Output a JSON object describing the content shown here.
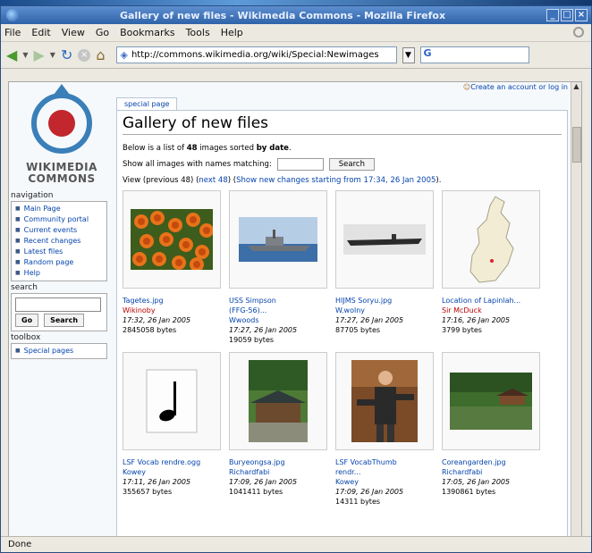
{
  "window": {
    "title": "Gallery of new files - Wikimedia Commons - Mozilla Firefox"
  },
  "menu": [
    "File",
    "Edit",
    "View",
    "Go",
    "Bookmarks",
    "Tools",
    "Help"
  ],
  "address": {
    "url": "http://commons.wikimedia.org/wiki/Special:Newimages"
  },
  "sidebar": {
    "logo_line1": "WIKIMEDIA",
    "logo_line2": "COMMONS",
    "nav_heading": "navigation",
    "nav_items": [
      "Main Page",
      "Community portal",
      "Current events",
      "Recent changes",
      "Latest files",
      "Random page",
      "Help"
    ],
    "search_heading": "search",
    "search_go": "Go",
    "search_btn": "Search",
    "toolbox_heading": "toolbox",
    "toolbox_items": [
      "Special pages"
    ]
  },
  "page": {
    "tab": "special page",
    "user_link": "Create an account or log in",
    "title": "Gallery of new files",
    "intro_prefix": "Below is a list of ",
    "intro_count": "48",
    "intro_mid": " images sorted ",
    "intro_sort": "by date",
    "intro_end": ".",
    "filter_label": "Show all images with names matching:",
    "filter_btn": "Search",
    "view_prefix": "View (previous 48) (",
    "view_next": "next 48",
    "view_mid": ") (",
    "view_link": "Show new changes starting from 17:34, 26 Jan 2005",
    "view_end": ")."
  },
  "gallery": [
    {
      "name": "Tagetes.jpg",
      "name2": "",
      "user": "Wikinoby",
      "user_red": true,
      "date": "17:32, 26 Jan 2005",
      "size": "2845058 bytes",
      "thumb": "flowers"
    },
    {
      "name": "USS Simpson",
      "name2": "(FFG-56)...",
      "user": "Wwoods",
      "user_red": false,
      "date": "17:27, 26 Jan 2005",
      "size": "19059 bytes",
      "thumb": "ship"
    },
    {
      "name": "HIJMS Soryu.jpg",
      "name2": "",
      "user": "W.wolny",
      "user_red": false,
      "date": "17:27, 26 Jan 2005",
      "size": "87705 bytes",
      "thumb": "carrier"
    },
    {
      "name": "Location of Lapinlah...",
      "name2": "",
      "user": "Sir McDuck",
      "user_red": true,
      "date": "17:16, 26 Jan 2005",
      "size": "3799 bytes",
      "thumb": "map"
    },
    {
      "name": "LSF Vocab rendre.ogg",
      "name2": "",
      "user": "Kowey",
      "user_red": false,
      "date": "17:11, 26 Jan 2005",
      "size": "355657 bytes",
      "thumb": "note"
    },
    {
      "name": "Buryeongsa.jpg",
      "name2": "",
      "user": "Richardfabi",
      "user_red": false,
      "date": "17:09, 26 Jan 2005",
      "size": "1041411 bytes",
      "thumb": "temple"
    },
    {
      "name": "LSF VocabThumb",
      "name2": "rendr...",
      "user": "Kowey",
      "user_red": false,
      "date": "17:09, 26 Jan 2005",
      "size": "14311 bytes",
      "thumb": "person"
    },
    {
      "name": "Coreangarden.jpg",
      "name2": "",
      "user": "Richardfabi",
      "user_red": false,
      "date": "17:05, 26 Jan 2005",
      "size": "1390861 bytes",
      "thumb": "garden"
    }
  ],
  "status": {
    "text": "Done"
  }
}
